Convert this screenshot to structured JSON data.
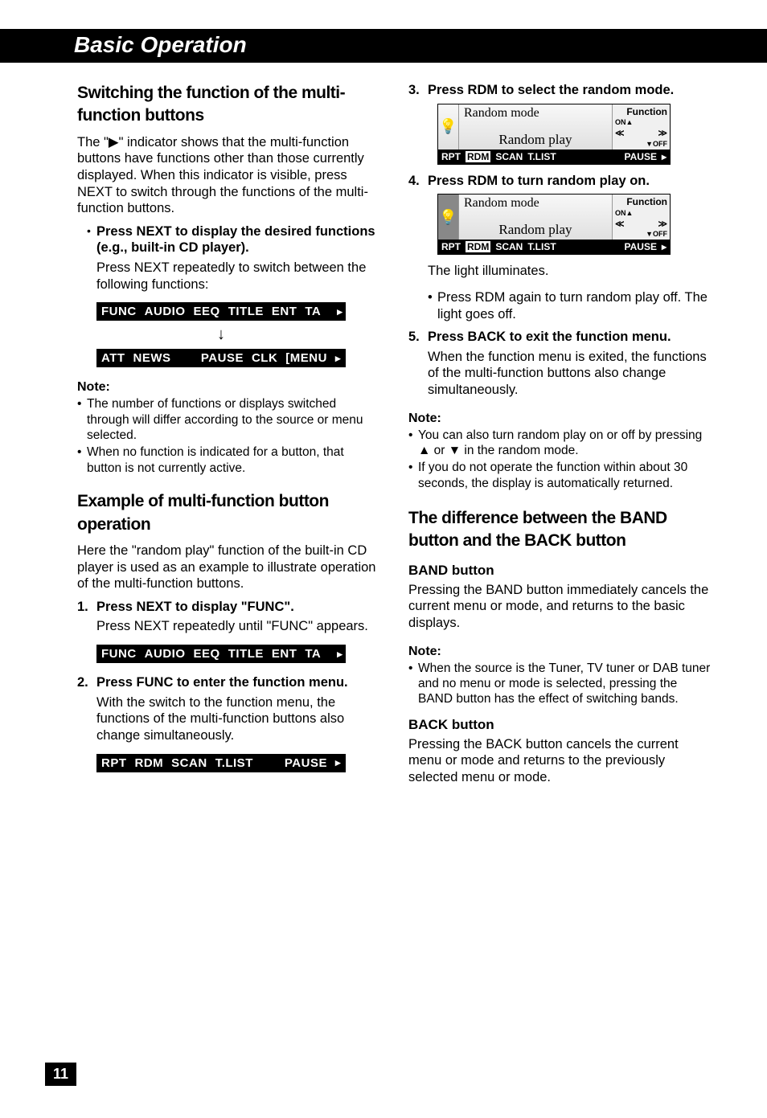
{
  "header": "Basic Operation",
  "left": {
    "h1": "Switching the function of the multi-function buttons",
    "intro": "The \"▶\" indicator shows that the multi-function buttons have functions other than those currently displayed. When this indicator is visible, press NEXT to switch through the functions of the multi-function buttons.",
    "bullet1": "Press NEXT to display the desired functions (e.g., built-in CD player).",
    "sub1": "Press NEXT repeatedly to switch between the following functions:",
    "lcd1": [
      "FUNC",
      "AUDIO",
      "EEQ",
      "TITLE",
      "ENT",
      "TA"
    ],
    "lcd2_left": [
      "ATT",
      "NEWS"
    ],
    "lcd2_right": [
      "PAUSE",
      "CLK",
      "[MENU"
    ],
    "note_head": "Note:",
    "note1": "The number of functions or displays switched through will differ according to the source or menu selected.",
    "note2": "When no function is indicated for a button, that button is not currently active.",
    "h2": "Example of multi-function button operation",
    "h2_intro": "Here the \"random play\" function of the built-in CD player is used as an example to illustrate operation of the multi-function buttons.",
    "step1": "Press NEXT to display \"FUNC\".",
    "step1_sub": "Press NEXT repeatedly until \"FUNC\" appears.",
    "lcd3": [
      "FUNC",
      "AUDIO",
      "EEQ",
      "TITLE",
      "ENT",
      "TA"
    ],
    "step2": "Press FUNC to enter the function menu.",
    "step2_sub": "With the switch to the function menu, the functions of the multi-function buttons also change simultaneously.",
    "lcd4_left": [
      "RPT",
      "RDM",
      "SCAN",
      "T.LIST"
    ],
    "lcd4_right": [
      "PAUSE"
    ]
  },
  "right": {
    "step3": "Press RDM to select the random mode.",
    "screen1": {
      "line1": "Random mode",
      "line2": "Random play",
      "func": "Function",
      "on": "ON▲",
      "voff": "▼OFF",
      "bottom_left": [
        "RPT"
      ],
      "bottom_hi": "RDM",
      "bottom_rest": [
        "SCAN",
        "T.LIST"
      ],
      "pause": "PAUSE"
    },
    "step4": "Press RDM to turn random play on.",
    "screen2": {
      "line1": "Random mode",
      "line2": "Random play",
      "func": "Function",
      "on": "ON▲",
      "voff": "▼OFF",
      "bottom_left": [
        "RPT"
      ],
      "bottom_hi": "RDM",
      "bottom_rest": [
        "SCAN",
        "T.LIST"
      ],
      "pause": "PAUSE"
    },
    "step4_sub": "The light illuminates.",
    "step4_bullet": "Press RDM again to turn random play off. The light goes off.",
    "step5": "Press BACK to exit the function menu.",
    "step5_sub": "When the function menu is exited, the functions of the multi-function buttons also change simultaneously.",
    "note_head": "Note:",
    "note1": "You can also turn random play on or off by pressing ▲ or ▼ in the random mode.",
    "note2": "If you do not operate the function within about 30 seconds, the display is automatically returned.",
    "h3": "The difference between the BAND button and the BACK button",
    "band_h": "BAND button",
    "band_p": "Pressing the BAND button immediately cancels the current menu or mode, and returns to the basic displays.",
    "band_note_head": "Note:",
    "band_note": "When the source is the Tuner, TV tuner or DAB tuner and no menu or mode is selected, pressing the BAND button has the effect of switching bands.",
    "back_h": "BACK button",
    "back_p": "Pressing the BACK button cancels the current menu or mode and returns to the previously selected menu or mode."
  },
  "page": "11"
}
